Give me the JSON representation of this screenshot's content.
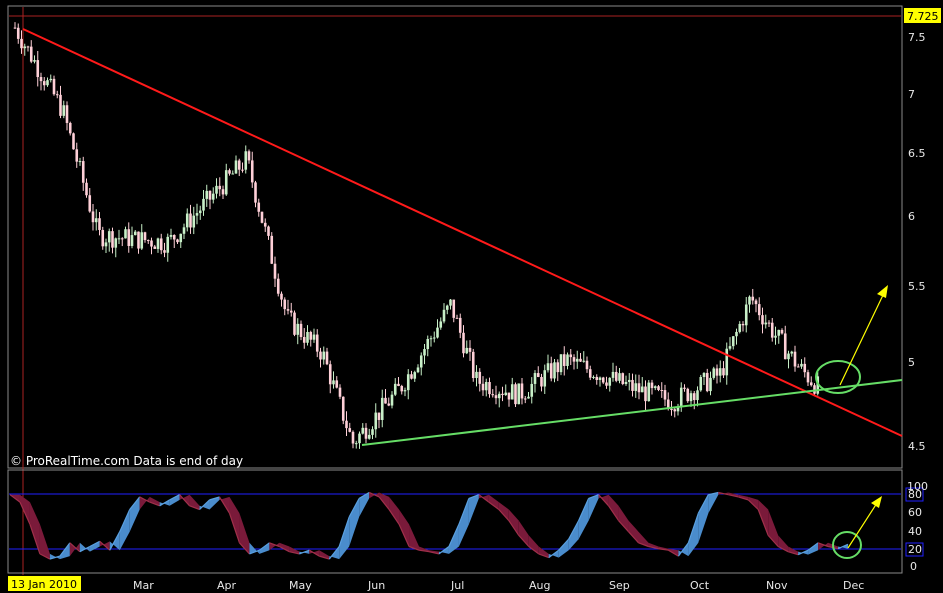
{
  "watermark": "© ProRealTime.com  Data is end of day",
  "date_badge": "13 Jan 2010",
  "last_price_badge": "7.725",
  "colors": {
    "background": "#000000",
    "bull_candle": "#c8f0c8",
    "bear_candle": "#ffd0d8",
    "down_trendline": "#ff1a1a",
    "up_trendline": "#66dd66",
    "annotation_arrow": "#ffff00",
    "highlight_circle": "#66dd66",
    "stoch_band": "#2020ff",
    "stoch_bull_fill": "#4a8ccc",
    "stoch_bear_fill": "#7a1a3a",
    "badge": "#ffff00"
  },
  "chart_data": [
    {
      "type": "candlestick",
      "title": "",
      "x_ticks": [
        "Mar",
        "Apr",
        "May",
        "Jun",
        "Jul",
        "Aug",
        "Sep",
        "Oct",
        "Nov",
        "Dec"
      ],
      "y_ticks": [
        "4.5",
        "5",
        "5.5",
        "6",
        "6.5",
        "7",
        "7.5"
      ],
      "ylim": [
        4.45,
        7.72
      ],
      "grid": false,
      "key_points": [
        {
          "date": "2010-01-13",
          "close": 7.55
        },
        {
          "date": "2010-02-01",
          "close": 6.95
        },
        {
          "date": "2010-02-15",
          "close": 6.05
        },
        {
          "date": "2010-03-15",
          "close": 6.0
        },
        {
          "date": "2010-04-15",
          "close": 6.6
        },
        {
          "date": "2010-05-01",
          "close": 5.45
        },
        {
          "date": "2010-05-15",
          "close": 5.2
        },
        {
          "date": "2010-05-27",
          "close": 4.55
        },
        {
          "date": "2010-06-15",
          "close": 4.95
        },
        {
          "date": "2010-07-05",
          "close": 5.55
        },
        {
          "date": "2010-07-15",
          "close": 5.0
        },
        {
          "date": "2010-08-01",
          "close": 4.9
        },
        {
          "date": "2010-08-20",
          "close": 5.15
        },
        {
          "date": "2010-09-15",
          "close": 4.95
        },
        {
          "date": "2010-10-01",
          "close": 4.85
        },
        {
          "date": "2010-10-20",
          "close": 5.05
        },
        {
          "date": "2010-11-01",
          "close": 5.6
        },
        {
          "date": "2010-11-10",
          "close": 5.35
        },
        {
          "date": "2010-11-20",
          "close": 5.1
        },
        {
          "date": "2010-11-28",
          "close": 4.95
        }
      ],
      "trendlines": [
        {
          "name": "",
          "color": "#ff1a1a",
          "from": {
            "date": "2010-01-13",
            "value": 7.58
          },
          "to": {
            "date": "2010-12-31",
            "value": 4.55
          }
        },
        {
          "name": "",
          "color": "#66dd66",
          "from": {
            "date": "2010-05-27",
            "value": 4.49
          },
          "to": {
            "date": "2010-12-31",
            "value": 4.88
          }
        }
      ],
      "last_value": 7.725
    },
    {
      "type": "line",
      "title": "",
      "y_ticks": [
        "0",
        "20",
        "40",
        "60",
        "80",
        "100"
      ],
      "ylim": [
        0,
        100
      ],
      "bands": [
        20,
        80
      ],
      "series": [
        {
          "values": [
            95,
            85,
            55,
            15,
            8,
            12,
            30,
            18,
            25,
            32,
            20,
            45,
            75,
            92,
            85,
            80,
            88,
            95,
            80,
            75,
            88,
            92,
            70,
            30,
            15,
            20,
            30,
            25,
            18,
            15,
            20,
            12,
            8,
            25,
            65,
            90,
            98,
            92,
            75,
            55,
            25,
            20,
            18,
            15,
            25,
            55,
            90,
            95,
            85,
            75,
            60,
            40,
            25,
            15,
            10,
            20,
            35,
            60,
            90,
            95,
            80,
            60,
            45,
            30,
            25,
            22,
            20,
            12,
            30,
            70,
            95,
            98,
            95,
            92,
            88,
            75,
            40,
            25,
            18,
            14,
            20,
            30,
            25,
            22,
            28
          ]
        }
      ]
    }
  ]
}
